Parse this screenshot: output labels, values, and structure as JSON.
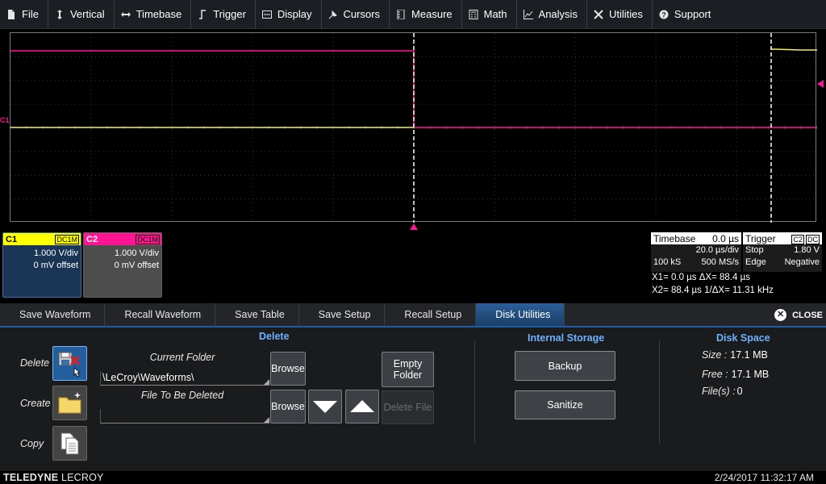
{
  "menu": [
    {
      "label": "File",
      "icon": "file-icon"
    },
    {
      "label": "Vertical",
      "icon": "vertical-arrows-icon"
    },
    {
      "label": "Timebase",
      "icon": "horizontal-arrows-icon"
    },
    {
      "label": "Trigger",
      "icon": "trigger-icon"
    },
    {
      "label": "Display",
      "icon": "display-icon"
    },
    {
      "label": "Cursors",
      "icon": "cursors-icon"
    },
    {
      "label": "Measure",
      "icon": "measure-icon"
    },
    {
      "label": "Math",
      "icon": "math-icon"
    },
    {
      "label": "Analysis",
      "icon": "analysis-icon"
    },
    {
      "label": "Utilities",
      "icon": "utilities-icon"
    },
    {
      "label": "Support",
      "icon": "support-icon"
    }
  ],
  "waveform": {
    "c1_marker": "C1",
    "c1_color": "#f0f060",
    "c2_color": "#ff1493",
    "cursor_color": "#ffffff",
    "trigger_color": "#ff1493"
  },
  "channels": {
    "c1": {
      "name": "C1",
      "coupling": "DC1M",
      "vdiv": "1.000 V/div",
      "offset": "0 mV offset",
      "color": "#ffff00"
    },
    "c2": {
      "name": "C2",
      "coupling": "DC1M",
      "vdiv": "1.000 V/div",
      "offset": "0 mV offset",
      "color": "#ff1493"
    }
  },
  "timebase": {
    "title": "Timebase",
    "delay": "0.0 µs",
    "per_div": "20.0 µs/div",
    "samples": "100 kS",
    "rate": "500 MS/s"
  },
  "trigger": {
    "title": "Trigger",
    "src": "C2",
    "cpl": "DC",
    "mode": "Stop",
    "level": "1.80 V",
    "type": "Edge",
    "slope": "Negative"
  },
  "cursors": {
    "line1": "X1= 0.0 µs   ΔX=     88.4 µs",
    "line2": "X2= 88.4 µs 1/ΔX= 11.31 kHz"
  },
  "tabs": [
    {
      "label": "Save Waveform",
      "active": false
    },
    {
      "label": "Recall Waveform",
      "active": false
    },
    {
      "label": "Save Table",
      "active": false
    },
    {
      "label": "Save Setup",
      "active": false
    },
    {
      "label": "Recall Setup",
      "active": false
    },
    {
      "label": "Disk Utilities",
      "active": true
    }
  ],
  "close_label": "CLOSE",
  "disk": {
    "delete_title": "Delete",
    "side": {
      "delete": "Delete",
      "create": "Create",
      "copy": "Copy"
    },
    "current_folder_label": "Current Folder",
    "current_folder_value": "\\LeCroy\\Waveforms\\",
    "file_label": "File To Be Deleted",
    "file_value": "",
    "browse": "Browse",
    "empty_folder": "Empty Folder",
    "delete_file": "Delete File",
    "internal_title": "Internal Storage",
    "backup": "Backup",
    "sanitize": "Sanitize",
    "space_title": "Disk Space",
    "size_label": "Size :",
    "size_value": "17.1 MB",
    "free_label": "Free :",
    "free_value": "17.1 MB",
    "files_label": "File(s) :",
    "files_value": "0"
  },
  "footer": {
    "brand_bold": "TELEDYNE",
    "brand_rest": " LECROY",
    "datetime": "2/24/2017 11:32:17 AM"
  }
}
